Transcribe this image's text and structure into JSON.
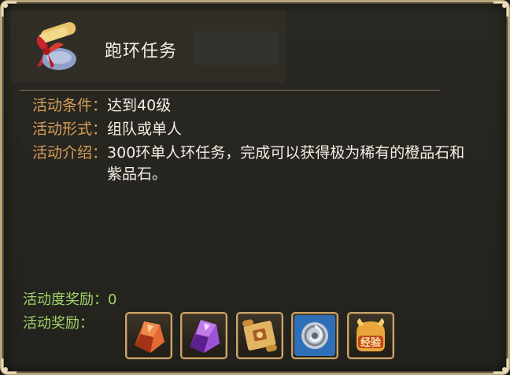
{
  "panel": {
    "title": "跑环任务",
    "condition_label": "活动条件：",
    "condition_value": "达到40级",
    "form_label": "活动形式：",
    "form_value": "组队或单人",
    "intro_label": "活动介绍：",
    "intro_value": "300环单人环任务，完成可以获得极为稀有的橙品石和紫品石。",
    "activity_reward_text": "活动度奖励：0",
    "reward_label": "活动奖励："
  },
  "rewards": [
    {
      "icon": "orange-gem-icon"
    },
    {
      "icon": "purple-gem-icon"
    },
    {
      "icon": "scroll-icon"
    },
    {
      "icon": "silver-orb-icon"
    },
    {
      "icon": "exp-icon",
      "text": "经验"
    }
  ],
  "colors": {
    "label": "#d79f5a",
    "value": "#f2efe6",
    "reward_text": "#9fd46a",
    "frame": "#b8a57a"
  }
}
